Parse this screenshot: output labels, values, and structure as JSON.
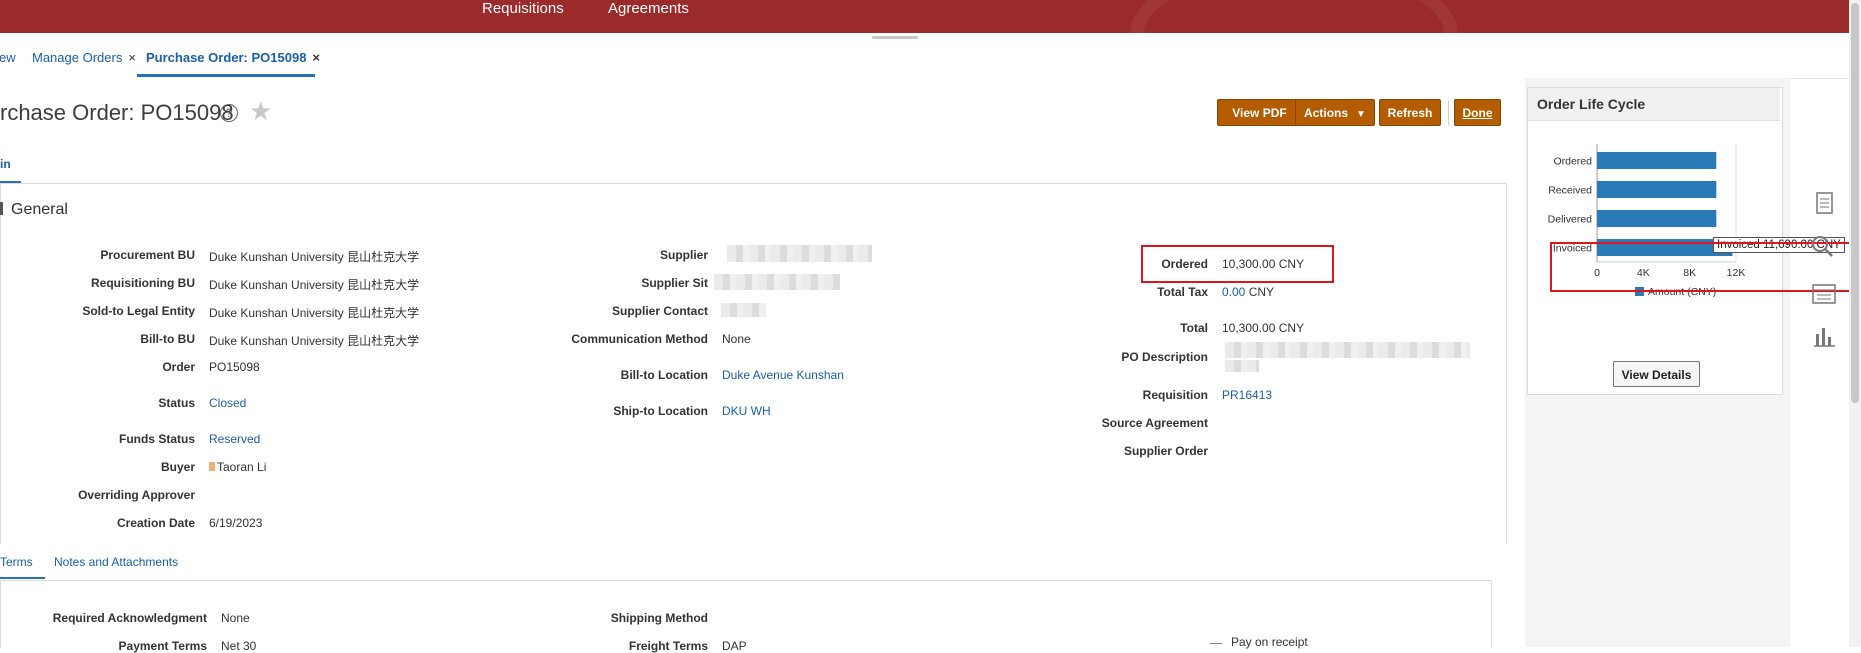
{
  "top_nav": {
    "requisitions": "Requisitions",
    "agreements": "Agreements"
  },
  "tabs": [
    {
      "label": "ew",
      "closable": false
    },
    {
      "label": "Manage Orders",
      "closable": true
    },
    {
      "label": "Purchase Order: PO15098",
      "closable": true,
      "active": true
    }
  ],
  "close_glyph": "×",
  "page": {
    "title": "rchase Order: PO15098",
    "help": "?",
    "star": "★"
  },
  "buttons": {
    "view_pdf": "View PDF",
    "actions": "Actions",
    "refresh": "Refresh",
    "done": "Done",
    "actions_caret": "▼"
  },
  "main_tab": "in",
  "general": {
    "heading": "General",
    "left": [
      {
        "label": "Procurement BU",
        "value": "Duke Kunshan University 昆山杜克大学"
      },
      {
        "label": "Requisitioning BU",
        "value": "Duke Kunshan University 昆山杜克大学"
      },
      {
        "label": "Sold-to Legal Entity",
        "value": "Duke Kunshan University 昆山杜克大学"
      },
      {
        "label": "Bill-to BU",
        "value": "Duke Kunshan University 昆山杜克大学"
      },
      {
        "label": "Order",
        "value": "PO15098"
      },
      {
        "label": "Status",
        "value": "Closed"
      },
      {
        "label": "Funds Status",
        "value": "Reserved"
      },
      {
        "label": "Buyer",
        "value": "Taoran Li"
      },
      {
        "label": "Overriding Approver",
        "value": ""
      },
      {
        "label": "Creation Date",
        "value": "6/19/2023"
      }
    ],
    "middle": [
      {
        "label": "Supplier",
        "value": ""
      },
      {
        "label": "Supplier Sit",
        "value": ""
      },
      {
        "label": "Supplier Contact",
        "value": ""
      },
      {
        "label": "Communication Method",
        "value": "None"
      },
      {
        "label": "Bill-to Location",
        "value": "Duke Avenue Kunshan"
      },
      {
        "label": "Ship-to Location",
        "value": "DKU WH"
      }
    ],
    "right": [
      {
        "label": "Ordered",
        "value": "10,300.00",
        "currency": "CNY"
      },
      {
        "label": "Total Tax",
        "value": "0.00",
        "currency": "CNY"
      },
      {
        "label": "Total",
        "value": "10,300.00",
        "currency": "CNY"
      },
      {
        "label": "PO Description",
        "value": ""
      },
      {
        "label": "Requisition",
        "value": "PR16413"
      },
      {
        "label": "Source Agreement",
        "value": ""
      },
      {
        "label": "Supplier Order",
        "value": ""
      }
    ]
  },
  "lower_tabs": {
    "terms": "Terms",
    "notes": "Notes and Attachments"
  },
  "terms": {
    "required_ack_label": "Required Acknowledgment",
    "required_ack_value": "None",
    "payment_terms_label": "Payment Terms",
    "payment_terms_value": "Net 30",
    "shipping_method_label": "Shipping Method",
    "freight_terms_label": "Freight Terms",
    "freight_terms_value": "DAP",
    "pay_on_receipt": "Pay on receipt"
  },
  "lifecycle": {
    "title": "Order Life Cycle",
    "view_details": "View Details",
    "tooltip": "Invoiced 11,690.00 CNY",
    "legend": "Amount (CNY)"
  },
  "colors": {
    "banner": "#9b2a2a",
    "button": "#b35c00",
    "bar": "#2a7ab8",
    "link": "#1a5fa8",
    "highlight": "#e0141e"
  },
  "chart_data": {
    "type": "bar",
    "orientation": "horizontal",
    "categories": [
      "Ordered",
      "Received",
      "Delivered",
      "Invoiced"
    ],
    "series": [
      {
        "name": "Amount (CNY)",
        "values": [
          10300,
          10300,
          10300,
          11690
        ]
      }
    ],
    "xlim": [
      0,
      12000
    ],
    "ticks": [
      "0",
      "4K",
      "8K",
      "12K"
    ],
    "legend": "bottom"
  }
}
